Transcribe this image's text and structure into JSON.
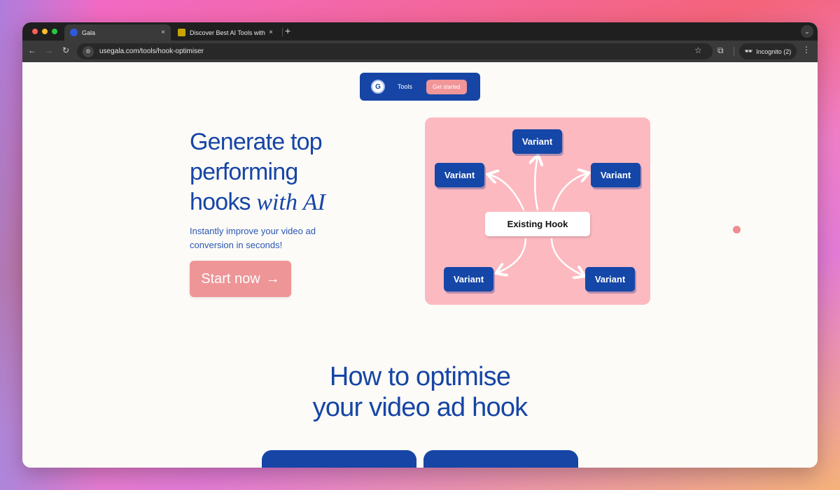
{
  "browser": {
    "tabs": [
      {
        "title": "Gala",
        "active": true,
        "favicon_color": "#2f59d8"
      },
      {
        "title": "Discover Best AI Tools with AI",
        "active": false,
        "favicon_color": "#c7a400"
      }
    ],
    "new_tab_glyph": "+",
    "close_glyph": "×",
    "url": "usegala.com/tools/hook-optimiser",
    "incognito_label": "Incognito (2)"
  },
  "nav": {
    "tools_label": "Tools",
    "cta_label": "Get started"
  },
  "hero": {
    "title_line1": "Generate top",
    "title_line2": "performing",
    "title_line3_plain": "hooks ",
    "title_line3_italic": "with AI",
    "subtitle": "Instantly improve your video ad conversion in seconds!",
    "button_label": "Start now",
    "button_arrow": "→"
  },
  "diagram": {
    "center_label": "Existing Hook",
    "variants": [
      "Variant",
      "Variant",
      "Variant",
      "Variant",
      "Variant"
    ]
  },
  "how": {
    "line1": "How to optimise",
    "line2": "your video ad hook"
  },
  "colors": {
    "brand_blue": "#1645a6",
    "accent_pink": "#ee9597",
    "diagram_bg": "#fdb9c0"
  }
}
